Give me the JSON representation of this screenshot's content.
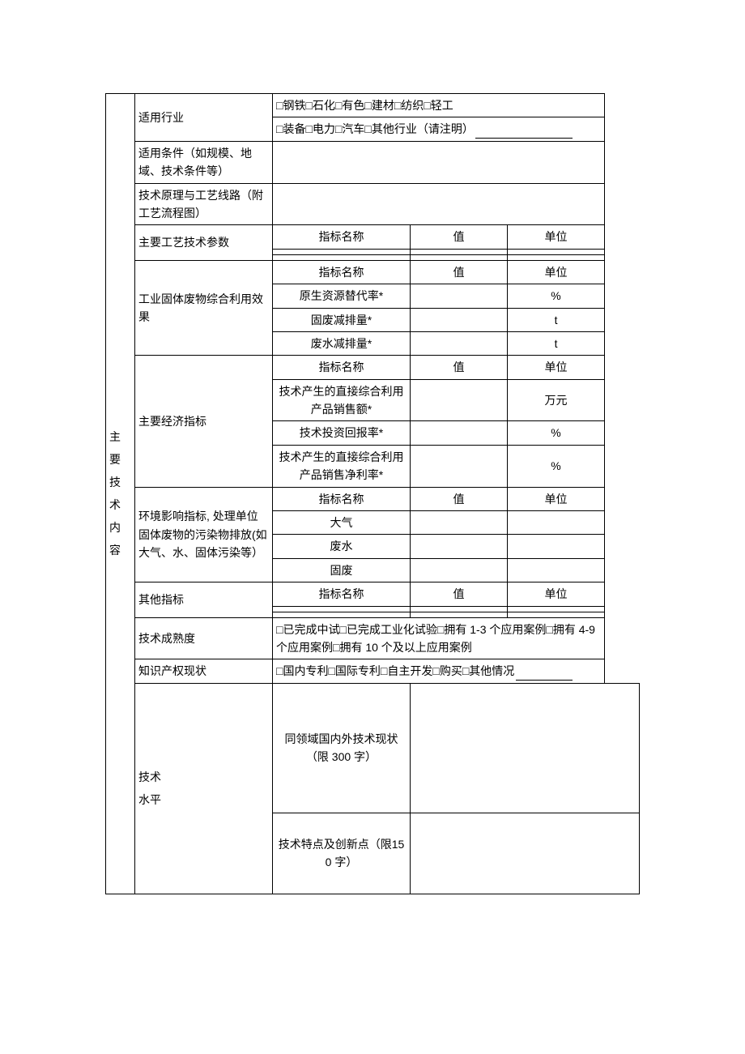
{
  "section1": {
    "heading": "主 要\n技 术\n内 容",
    "industry_label": "适用行业",
    "industry_options_row1": "□钢铁□石化□有色□建材□纺织□轻工",
    "industry_options_row2_prefix": "□装备□电力□汽车□其他行业（请注明）",
    "condition_label": "适用条件（如规模、地域、技术条件等）",
    "principle_label": "技术原理与工艺线路（附工艺流程图）",
    "header_name": "指标名称",
    "header_value": "值",
    "header_unit": "单位",
    "process_param_label": "主要工艺技术参数",
    "effect_label": "工业固体废物综合利用效果",
    "effect_rows": [
      {
        "name": "原生资源替代率*",
        "unit": "%"
      },
      {
        "name": "固废减排量*",
        "unit": "t"
      },
      {
        "name": "废水减排量*",
        "unit": "t"
      }
    ],
    "econ_label": "主要经济指标",
    "econ_rows": [
      {
        "name": "技术产生的直接综合利用产品销售额*",
        "unit": "万元"
      },
      {
        "name": "技术投资回报率*",
        "unit": "%"
      },
      {
        "name": "技术产生的直接综合利用产品销售净利率*",
        "unit": "%"
      }
    ],
    "env_label": "环境影响指标, 处理单位固体废物的污染物排放(如大气、水、固体污染等）",
    "env_rows": [
      {
        "name": "大气"
      },
      {
        "name": "废水"
      },
      {
        "name": "固废"
      }
    ],
    "other_label": "其他指标",
    "maturity_label": "技术成熟度",
    "maturity_options": "□已完成中试□已完成工业化试验□拥有 1-3 个应用案例□拥有 4-9 个应用案例□拥有 10 个及以上应用案例",
    "ip_label": "知识产权现状",
    "ip_options": "□国内专利□国际专利□自主开发□购买□其他情况"
  },
  "section2": {
    "heading": "技术\n水平",
    "status300_label": "同领域国内外技术现状（限 300 字）",
    "feature150_label": "技术特点及创新点（限150 字）"
  }
}
